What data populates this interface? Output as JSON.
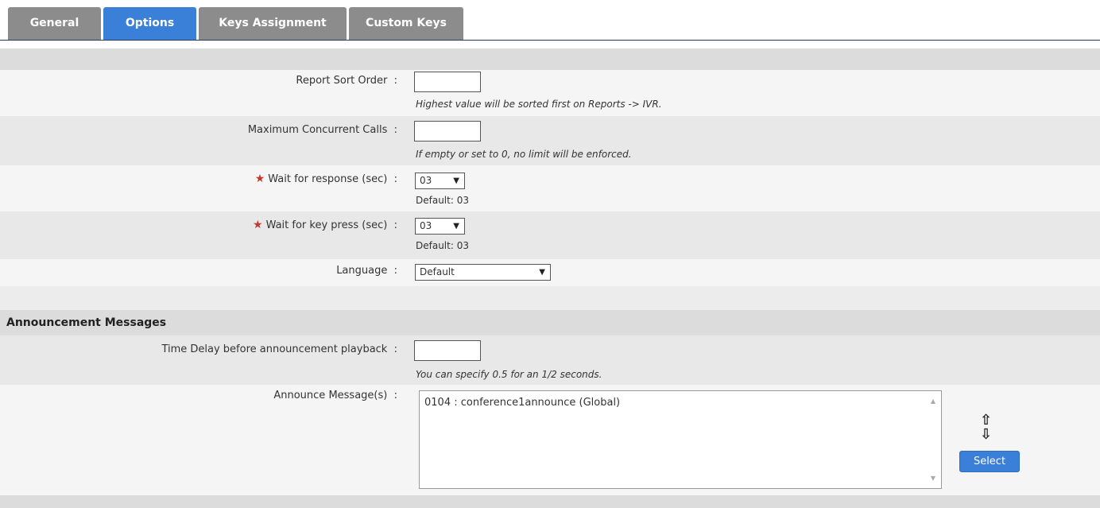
{
  "tabs": [
    {
      "label": "General",
      "active": false
    },
    {
      "label": "Options",
      "active": true
    },
    {
      "label": "Keys Assignment",
      "active": false
    },
    {
      "label": "Custom Keys",
      "active": false
    }
  ],
  "options": {
    "report_sort_order": {
      "label": "Report Sort Order",
      "value": "",
      "hint": "Highest value will be sorted first on Reports -> IVR."
    },
    "max_concurrent_calls": {
      "label": "Maximum Concurrent Calls",
      "value": "",
      "hint": "If empty or set to 0, no limit will be enforced."
    },
    "wait_for_response": {
      "label": "Wait for response (sec)",
      "required": true,
      "value": "03",
      "default": "Default: 03"
    },
    "wait_for_key_press": {
      "label": "Wait for key press (sec)",
      "required": true,
      "value": "03",
      "default": "Default: 03"
    },
    "language": {
      "label": "Language",
      "value": "Default"
    },
    "separator": ":"
  },
  "announcement": {
    "section_title": "Announcement Messages",
    "time_delay": {
      "label": "Time Delay before announcement playback",
      "value": "",
      "hint": "You can specify 0.5 for an 1/2 seconds."
    },
    "messages": {
      "label": "Announce Message(s)",
      "items": [
        "0104 : conference1announce (Global)"
      ]
    },
    "select_button": "Select"
  },
  "colors": {
    "accent": "#3a7fd8",
    "tab_inactive": "#8c8c8c",
    "required": "#c0392b"
  },
  "icons": {
    "move_up": "up-arrow-icon",
    "move_down": "down-arrow-icon"
  }
}
